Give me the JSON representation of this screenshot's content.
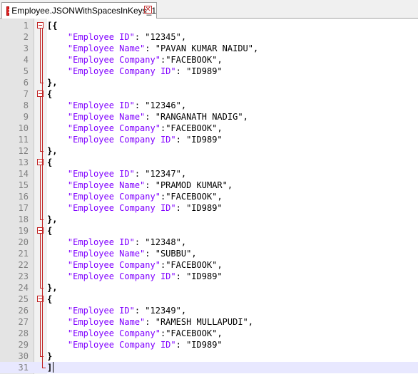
{
  "tab": {
    "title": "Employee.JSONWithSpacesInKeys_1",
    "close_glyph": "✕",
    "icon": "file-modified-icon"
  },
  "editor": {
    "lines": [
      {
        "num": "1",
        "text": "[{"
      },
      {
        "num": "2",
        "key": "\"Employee ID\"",
        "sep": ": ",
        "val": "\"12345\"",
        "end": ","
      },
      {
        "num": "3",
        "key": "\"Employee Name\"",
        "sep": ": ",
        "val": "\"PAVAN KUMAR NAIDU\"",
        "end": ","
      },
      {
        "num": "4",
        "key": "\"Employee Company\"",
        "sep": ":",
        "val": "\"FACEBOOK\"",
        "end": ","
      },
      {
        "num": "5",
        "key": "\"Employee Company ID\"",
        "sep": ": ",
        "val": "\"ID989\"",
        "end": ""
      },
      {
        "num": "6",
        "text": "},"
      },
      {
        "num": "7",
        "text": "{"
      },
      {
        "num": "8",
        "key": "\"Employee ID\"",
        "sep": ": ",
        "val": "\"12346\"",
        "end": ","
      },
      {
        "num": "9",
        "key": "\"Employee Name\"",
        "sep": ": ",
        "val": "\"RANGANATH NADIG\"",
        "end": ","
      },
      {
        "num": "10",
        "key": "\"Employee Company\"",
        "sep": ":",
        "val": "\"FACEBOOK\"",
        "end": ","
      },
      {
        "num": "11",
        "key": "\"Employee Company ID\"",
        "sep": ": ",
        "val": "\"ID989\"",
        "end": ""
      },
      {
        "num": "12",
        "text": "},"
      },
      {
        "num": "13",
        "text": "{"
      },
      {
        "num": "14",
        "key": "\"Employee ID\"",
        "sep": ": ",
        "val": "\"12347\"",
        "end": ","
      },
      {
        "num": "15",
        "key": "\"Employee Name\"",
        "sep": ": ",
        "val": "\"PRAMOD KUMAR\"",
        "end": ","
      },
      {
        "num": "16",
        "key": "\"Employee Company\"",
        "sep": ":",
        "val": "\"FACEBOOK\"",
        "end": ","
      },
      {
        "num": "17",
        "key": "\"Employee Company ID\"",
        "sep": ": ",
        "val": "\"ID989\"",
        "end": ""
      },
      {
        "num": "18",
        "text": "},"
      },
      {
        "num": "19",
        "text": "{"
      },
      {
        "num": "20",
        "key": "\"Employee ID\"",
        "sep": ": ",
        "val": "\"12348\"",
        "end": ","
      },
      {
        "num": "21",
        "key": "\"Employee Name\"",
        "sep": ": ",
        "val": "\"SUBBU\"",
        "end": ","
      },
      {
        "num": "22",
        "key": "\"Employee Company\"",
        "sep": ":",
        "val": "\"FACEBOOK\"",
        "end": ","
      },
      {
        "num": "23",
        "key": "\"Employee Company ID\"",
        "sep": ": ",
        "val": "\"ID989\"",
        "end": ""
      },
      {
        "num": "24",
        "text": "},"
      },
      {
        "num": "25",
        "text": "{"
      },
      {
        "num": "26",
        "key": "\"Employee ID\"",
        "sep": ": ",
        "val": "\"12349\"",
        "end": ","
      },
      {
        "num": "27",
        "key": "\"Employee Name\"",
        "sep": ": ",
        "val": "\"RAMESH MULLAPUDI\"",
        "end": ","
      },
      {
        "num": "28",
        "key": "\"Employee Company\"",
        "sep": ":",
        "val": "\"FACEBOOK\"",
        "end": ","
      },
      {
        "num": "29",
        "key": "\"Employee Company ID\"",
        "sep": ": ",
        "val": "\"ID989\"",
        "end": ""
      },
      {
        "num": "30",
        "text": "}"
      },
      {
        "num": "31",
        "text": "]"
      }
    ],
    "current_line": "31",
    "colors": {
      "key": "#8000ff",
      "gutter": "#e4e4e4",
      "fold_marker": "#c02020",
      "current_line_bg": "#e8e8ff"
    }
  }
}
